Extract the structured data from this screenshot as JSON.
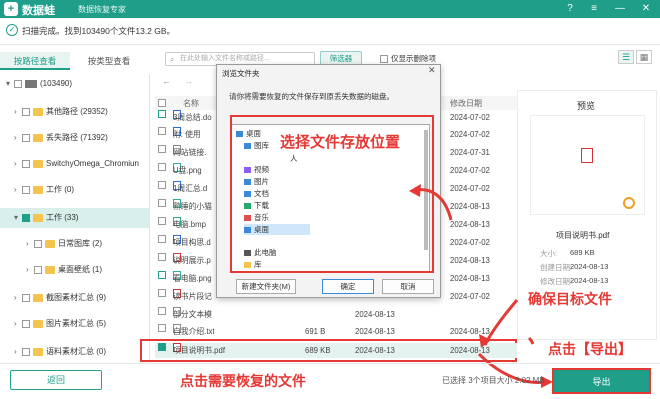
{
  "titlebar": {
    "logo": "+",
    "app_name": "数据蛙",
    "subtitle": "数据恢复专家",
    "help": "?",
    "menu": "≡",
    "minimize": "—",
    "close": "✕"
  },
  "status": {
    "text": "扫描完成。找到103490个文件13.2 GB。"
  },
  "tabs": {
    "path": "按路径查看",
    "type": "按类型查看"
  },
  "toolbar": {
    "search_placeholder": "在此处输入文件名称或路径...",
    "filter": "筛选器",
    "deleted_only": "仅显示删除项"
  },
  "tree": [
    {
      "label": "(103490)",
      "checked": false
    },
    {
      "label": "其他路径 (29352)"
    },
    {
      "label": "丢失路径 (71392)"
    },
    {
      "label": "SwitchyOmega_Chromiun"
    },
    {
      "label": "工作 (0)"
    },
    {
      "label": "工作 (33)"
    },
    {
      "label": "日常图库 (2)"
    },
    {
      "label": "桌面壁纸 (1)"
    },
    {
      "label": "截图素材汇总 (9)"
    },
    {
      "label": "图片素材汇总 (5)"
    },
    {
      "label": "语料素材汇总 (0)"
    }
  ],
  "list": {
    "columns": {
      "name": "名称",
      "modified": "修改日期"
    },
    "rows": [
      {
        "name": "3周总结.do",
        "date": "2024-07-02"
      },
      {
        "name": "附: 使用",
        "date": "2024-07-02"
      },
      {
        "name": "网站链接.",
        "date": "2024-07-31"
      },
      {
        "name": "U盘.png",
        "date": "2024-07-02"
      },
      {
        "name": "1周汇总.d",
        "date": "2024-07-02"
      },
      {
        "name": "熟睡的小猫",
        "date": "2024-08-13"
      },
      {
        "name": "电脑.bmp",
        "date": "2024-08-13"
      },
      {
        "name": "项目构思.d",
        "date": "2024-07-02"
      },
      {
        "name": "说明展示.p",
        "date": "2024-08-13"
      },
      {
        "name": "看电脑.png",
        "date": "2024-08-13"
      },
      {
        "name": "读书片段记",
        "date": "2024-07-02"
      },
      {
        "name": "部分文本模",
        "size": "",
        "date": "2024-08-13"
      },
      {
        "name": "自我介绍.txt",
        "size": "691 B",
        "date": "2024-08-13",
        "date2": "2024-08-13"
      },
      {
        "name": "项目说明书.pdf",
        "size": "689 KB",
        "date": "2024-08-13",
        "date2": "2024-08-13"
      }
    ]
  },
  "preview": {
    "title": "预览",
    "filename": "项目说明书.pdf",
    "size_key": "大小:",
    "size_val": "689 KB",
    "created_key": "创建日期:",
    "created_val": "2024-08-13",
    "modified_key": "修改日期:",
    "modified_val": "2024-08-13"
  },
  "dialog": {
    "title": "浏览文件夹",
    "close": "✕",
    "message": "请你将需要恢复的文件保存到原丢失数据的磁盘。",
    "items": [
      "桌面",
      "图库",
      "人",
      "视频",
      "图片",
      "文档",
      "下载",
      "音乐",
      "桌面",
      "此电脑",
      "库"
    ],
    "new_folder": "新建文件夹(M)",
    "ok": "确定",
    "cancel": "取消"
  },
  "annotations": {
    "choose_location": "选择文件存放位置",
    "confirm_file": "确保目标文件",
    "click_export": "点击【导出】",
    "click_file": "点击需要恢复的文件"
  },
  "bottom": {
    "back": "返回",
    "selected": "已选择 3个项目大小 2.02 MB",
    "export": "导出"
  }
}
